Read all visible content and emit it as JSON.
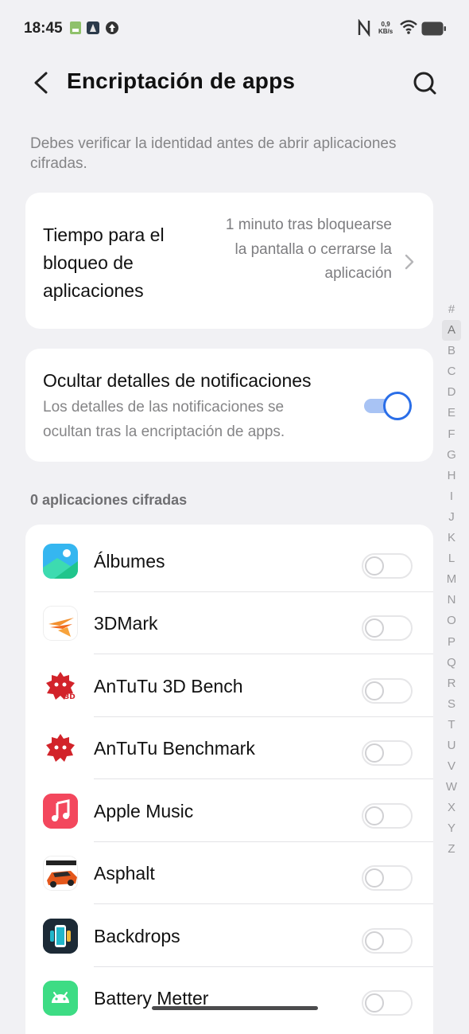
{
  "status_bar": {
    "time": "18:45",
    "net_speed_value": "0,9",
    "net_speed_unit": "KB/s"
  },
  "header": {
    "title": "Encriptación de apps"
  },
  "description": "Debes verificar la identidad antes de abrir aplicaciones cifradas.",
  "lock_time": {
    "label": "Tiempo para el bloqueo de aplicaciones",
    "value": "1 minuto tras bloquearse la pantalla o cerrarse la aplicación"
  },
  "hide_notifications": {
    "label": "Ocultar detalles de notificaciones",
    "subtitle": "Los detalles de las notificaciones se ocultan tras la encriptación de apps.",
    "enabled": true
  },
  "section_label": "0 aplicaciones cifradas",
  "apps": [
    {
      "name": "Álbumes",
      "icon": "albums-icon",
      "enabled": false
    },
    {
      "name": "3DMark",
      "icon": "3dmark-icon",
      "enabled": false
    },
    {
      "name": "AnTuTu 3D Bench",
      "icon": "antutu-3d-icon",
      "enabled": false
    },
    {
      "name": "AnTuTu Benchmark",
      "icon": "antutu-icon",
      "enabled": false
    },
    {
      "name": "Apple Music",
      "icon": "apple-music-icon",
      "enabled": false
    },
    {
      "name": "Asphalt",
      "icon": "asphalt-icon",
      "enabled": false
    },
    {
      "name": "Backdrops",
      "icon": "backdrops-icon",
      "enabled": false
    },
    {
      "name": "Battery Metter",
      "icon": "battery-metter-icon",
      "enabled": false
    }
  ],
  "index_letters": [
    "#",
    "A",
    "B",
    "C",
    "D",
    "E",
    "F",
    "G",
    "H",
    "I",
    "J",
    "K",
    "L",
    "M",
    "N",
    "O",
    "P",
    "Q",
    "R",
    "S",
    "T",
    "U",
    "V",
    "W",
    "X",
    "Y",
    "Z"
  ],
  "index_selected": "A",
  "colors": {
    "accent": "#2a6ee8",
    "background": "#f1f1f4"
  }
}
